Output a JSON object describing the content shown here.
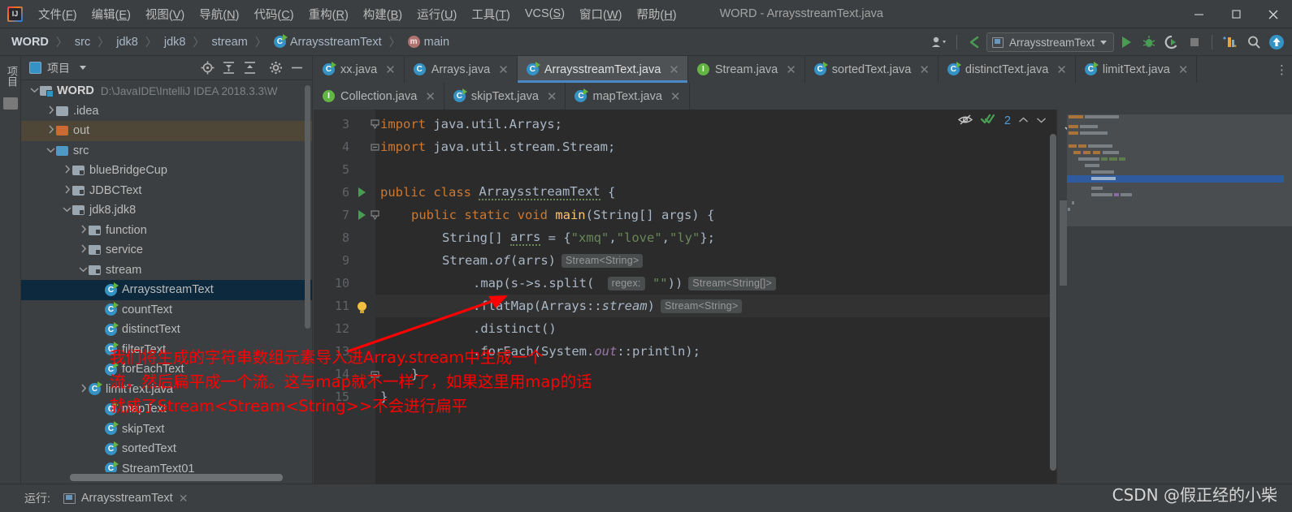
{
  "window": {
    "title": "WORD - ArraysstreamText.java",
    "logo_icon": "intellij-idea-logo",
    "minimize_label": "─",
    "maximize_label": "❑",
    "close_label": "✕"
  },
  "menubar": {
    "items": [
      {
        "label": "文件(F)",
        "mnemonic": "F"
      },
      {
        "label": "编辑(E)",
        "mnemonic": "E"
      },
      {
        "label": "视图(V)",
        "mnemonic": "V"
      },
      {
        "label": "导航(N)",
        "mnemonic": "N"
      },
      {
        "label": "代码(C)",
        "mnemonic": "C"
      },
      {
        "label": "重构(R)",
        "mnemonic": "R"
      },
      {
        "label": "构建(B)",
        "mnemonic": "B"
      },
      {
        "label": "运行(U)",
        "mnemonic": "U"
      },
      {
        "label": "工具(T)",
        "mnemonic": "T"
      },
      {
        "label": "VCS(S)",
        "mnemonic": "S"
      },
      {
        "label": "窗口(W)",
        "mnemonic": "W"
      },
      {
        "label": "帮助(H)",
        "mnemonic": "H"
      }
    ]
  },
  "navbar": {
    "crumbs": [
      {
        "label": "WORD",
        "icon": "none"
      },
      {
        "label": "src",
        "icon": "none"
      },
      {
        "label": "jdk8",
        "icon": "none"
      },
      {
        "label": "jdk8",
        "icon": "none"
      },
      {
        "label": "stream",
        "icon": "none"
      },
      {
        "label": "ArraysstreamText",
        "icon": "class-runnable-icon"
      },
      {
        "label": "main",
        "icon": "method-icon"
      }
    ],
    "separator": "〉",
    "run_config": {
      "name": "ArraysstreamText",
      "dropdown_icon": "chevron-down-icon"
    },
    "buttons": [
      {
        "name": "user-switch-icon"
      },
      {
        "name": "back-arrow-icon"
      },
      {
        "name": "run-icon"
      },
      {
        "name": "debug-icon"
      },
      {
        "name": "run-coverage-icon"
      },
      {
        "name": "stop-icon"
      },
      {
        "name": "build-icon"
      },
      {
        "name": "search-icon"
      },
      {
        "name": "update-project-icon"
      }
    ]
  },
  "left_stripe": {
    "tab_label": "项目",
    "structure_icon": "structure-icon"
  },
  "project_panel": {
    "title": "项目",
    "title_icon": "project-icon",
    "dropdown_icon": "chevron-down-icon",
    "header_buttons": [
      {
        "name": "locate-icon"
      },
      {
        "name": "expand-all-icon"
      },
      {
        "name": "collapse-all-icon"
      },
      {
        "name": "settings-gear-icon"
      },
      {
        "name": "hide-icon"
      }
    ],
    "tree": [
      {
        "label": "WORD",
        "path": "D:\\JavaIDE\\IntelliJ IDEA 2018.3.3\\W",
        "indent": 0,
        "arrow": "v",
        "icon": "project-root-folder",
        "bold": true,
        "state": "normal"
      },
      {
        "label": ".idea",
        "path": "",
        "indent": 1,
        "arrow": ">",
        "icon": "folder-gray",
        "bold": false,
        "state": "normal"
      },
      {
        "label": "out",
        "path": "",
        "indent": 1,
        "arrow": ">",
        "icon": "folder-orange",
        "bold": false,
        "state": "out"
      },
      {
        "label": "src",
        "path": "",
        "indent": 1,
        "arrow": "v",
        "icon": "folder-blue",
        "bold": false,
        "state": "normal"
      },
      {
        "label": "blueBridgeCup",
        "path": "",
        "indent": 2,
        "arrow": ">",
        "icon": "folder-module",
        "bold": false,
        "state": "normal"
      },
      {
        "label": "JDBCText",
        "path": "",
        "indent": 2,
        "arrow": ">",
        "icon": "folder-module",
        "bold": false,
        "state": "normal"
      },
      {
        "label": "jdk8.jdk8",
        "path": "",
        "indent": 2,
        "arrow": "v",
        "icon": "folder-module",
        "bold": false,
        "state": "normal"
      },
      {
        "label": "function",
        "path": "",
        "indent": 3,
        "arrow": ">",
        "icon": "folder-module",
        "bold": false,
        "state": "normal"
      },
      {
        "label": "service",
        "path": "",
        "indent": 3,
        "arrow": ">",
        "icon": "folder-module",
        "bold": false,
        "state": "normal"
      },
      {
        "label": "stream",
        "path": "",
        "indent": 3,
        "arrow": "v",
        "icon": "folder-module",
        "bold": false,
        "state": "normal"
      },
      {
        "label": "ArraysstreamText",
        "path": "",
        "indent": 4,
        "arrow": "",
        "icon": "class-runnable-icon",
        "bold": false,
        "state": "selected"
      },
      {
        "label": "countText",
        "path": "",
        "indent": 4,
        "arrow": "",
        "icon": "class-runnable-icon",
        "bold": false,
        "state": "normal"
      },
      {
        "label": "distinctText",
        "path": "",
        "indent": 4,
        "arrow": "",
        "icon": "class-runnable-icon",
        "bold": false,
        "state": "normal"
      },
      {
        "label": "filterText",
        "path": "",
        "indent": 4,
        "arrow": "",
        "icon": "class-runnable-icon",
        "bold": false,
        "state": "normal"
      },
      {
        "label": "forEachText",
        "path": "",
        "indent": 4,
        "arrow": "",
        "icon": "class-runnable-icon",
        "bold": false,
        "state": "normal"
      },
      {
        "label": "limitText.java",
        "path": "",
        "indent": 3,
        "arrow": ">",
        "icon": "class-runnable-icon",
        "bold": false,
        "state": "normal"
      },
      {
        "label": "mapText",
        "path": "",
        "indent": 4,
        "arrow": "",
        "icon": "class-runnable-icon",
        "bold": false,
        "state": "normal"
      },
      {
        "label": "skipText",
        "path": "",
        "indent": 4,
        "arrow": "",
        "icon": "class-runnable-icon",
        "bold": false,
        "state": "normal"
      },
      {
        "label": "sortedText",
        "path": "",
        "indent": 4,
        "arrow": "",
        "icon": "class-runnable-icon",
        "bold": false,
        "state": "normal"
      },
      {
        "label": "StreamText01",
        "path": "",
        "indent": 4,
        "arrow": "",
        "icon": "class-runnable-icon",
        "bold": false,
        "state": "normal"
      }
    ]
  },
  "editor_tabs": {
    "row1": [
      {
        "label": "xx.java",
        "icon": "class-runnable-icon",
        "active": false
      },
      {
        "label": "Arrays.java",
        "icon": "class-icon",
        "active": false
      },
      {
        "label": "ArraysstreamText.java",
        "icon": "class-runnable-icon",
        "active": true
      },
      {
        "label": "Stream.java",
        "icon": "interface-icon",
        "active": false
      },
      {
        "label": "sortedText.java",
        "icon": "class-runnable-icon",
        "active": false
      },
      {
        "label": "distinctText.java",
        "icon": "class-runnable-icon",
        "active": false
      },
      {
        "label": "limitText.java",
        "icon": "class-runnable-icon",
        "active": false
      }
    ],
    "row2": [
      {
        "label": "Collection.java",
        "icon": "interface-icon",
        "active": false
      },
      {
        "label": "skipText.java",
        "icon": "class-runnable-icon",
        "active": false
      },
      {
        "label": "mapText.java",
        "icon": "class-runnable-icon",
        "active": false
      }
    ],
    "close_label": "✕",
    "more_label": "⋮"
  },
  "editor": {
    "status": {
      "eye_icon": "hide-inspections-icon",
      "check_icon": "inspections-ok-icon",
      "warning_count": "2",
      "prev_icon": "chevron-up-icon",
      "next_icon": "chevron-down-icon"
    },
    "lines": [
      {
        "num": "3",
        "indent": 0,
        "marker": "",
        "fold": "top",
        "tokens": [
          {
            "t": "import ",
            "c": "kw"
          },
          {
            "t": "java.util.Arrays;",
            "c": "txt"
          }
        ]
      },
      {
        "num": "4",
        "indent": 0,
        "marker": "",
        "fold": "end",
        "tokens": [
          {
            "t": "import ",
            "c": "kw"
          },
          {
            "t": "java.util.stream.Stream;",
            "c": "txt"
          }
        ]
      },
      {
        "num": "5",
        "indent": 0,
        "marker": "",
        "fold": "",
        "tokens": []
      },
      {
        "num": "6",
        "indent": 0,
        "marker": "run",
        "fold": "",
        "tokens": [
          {
            "t": "public class ",
            "c": "kw"
          },
          {
            "t": "ArraysstreamText",
            "c": "warn"
          },
          {
            "t": " {",
            "c": "txt"
          }
        ]
      },
      {
        "num": "7",
        "indent": 1,
        "marker": "run",
        "fold": "top",
        "tokens": [
          {
            "t": "public static void ",
            "c": "kw"
          },
          {
            "t": "main",
            "c": "mth"
          },
          {
            "t": "(String[] args) {",
            "c": "txt"
          }
        ]
      },
      {
        "num": "8",
        "indent": 2,
        "marker": "",
        "fold": "",
        "tokens": [
          {
            "t": "String[] ",
            "c": "txt"
          },
          {
            "t": "arrs",
            "c": "warn"
          },
          {
            "t": " = {",
            "c": "txt"
          },
          {
            "t": "\"xmq\"",
            "c": "str"
          },
          {
            "t": ",",
            "c": "txt"
          },
          {
            "t": "\"love\"",
            "c": "str"
          },
          {
            "t": ",",
            "c": "txt"
          },
          {
            "t": "\"ly\"",
            "c": "str"
          },
          {
            "t": "};",
            "c": "txt"
          }
        ]
      },
      {
        "num": "9",
        "indent": 2,
        "marker": "",
        "fold": "",
        "tokens": [
          {
            "t": "Stream.",
            "c": "txt"
          },
          {
            "t": "of",
            "c": "ital"
          },
          {
            "t": "(arrs)",
            "c": "txt"
          },
          {
            "t": "Stream<String>",
            "c": "hint"
          }
        ]
      },
      {
        "num": "10",
        "indent": 3,
        "marker": "",
        "fold": "",
        "tokens": [
          {
            "t": ".map(s->s.split( ",
            "c": "txt"
          },
          {
            "t": "regex:",
            "c": "hint"
          },
          {
            "t": " ",
            "c": "txt"
          },
          {
            "t": "\"\"",
            "c": "str"
          },
          {
            "t": "))",
            "c": "txt"
          },
          {
            "t": "Stream<String[]>",
            "c": "hint"
          }
        ]
      },
      {
        "num": "11",
        "indent": 3,
        "marker": "bulb",
        "fold": "",
        "caret": true,
        "tokens": [
          {
            "t": ".flatMap(Arrays::",
            "c": "txt"
          },
          {
            "t": "stream",
            "c": "ital"
          },
          {
            "t": ")",
            "c": "txt"
          },
          {
            "t": "Stream<String>",
            "c": "hint"
          }
        ]
      },
      {
        "num": "12",
        "indent": 3,
        "marker": "",
        "fold": "",
        "tokens": [
          {
            "t": ".distinct()",
            "c": "txt"
          }
        ]
      },
      {
        "num": "13",
        "indent": 3,
        "marker": "",
        "fold": "",
        "tokens": [
          {
            "t": ".forEach(System.",
            "c": "txt"
          },
          {
            "t": "out",
            "c": "fld"
          },
          {
            "t": "::println);",
            "c": "txt"
          }
        ]
      },
      {
        "num": "14",
        "indent": 1,
        "marker": "",
        "fold": "end",
        "tokens": [
          {
            "t": "}",
            "c": "txt"
          }
        ]
      },
      {
        "num": "15",
        "indent": 0,
        "marker": "",
        "fold": "",
        "tokens": [
          {
            "t": "}",
            "c": "txt"
          }
        ]
      }
    ]
  },
  "annotation": {
    "color": "#ff0000",
    "arrow_icon": "red-arrow-icon",
    "lines": [
      "我们将生成的字符串数组元素导入进Array.stream中生成一个",
      "流，然后扁平成一个流。这与map就不一样了，如果这里用map的话",
      "就成了Stream<Stream<String>>不会进行扁平"
    ]
  },
  "bottom_bar": {
    "run_label": "运行:",
    "run_tab": "ArraysstreamText",
    "close_label": "✕"
  },
  "watermark": "CSDN @假正经的小柴",
  "colors": {
    "background": "#3c3f41",
    "editor_bg": "#2b2b2b",
    "accent": "#4a88c7",
    "selection": "#0d293e",
    "keyword": "#cc7832",
    "string": "#6a8759",
    "annotation_red": "#ff0000"
  }
}
